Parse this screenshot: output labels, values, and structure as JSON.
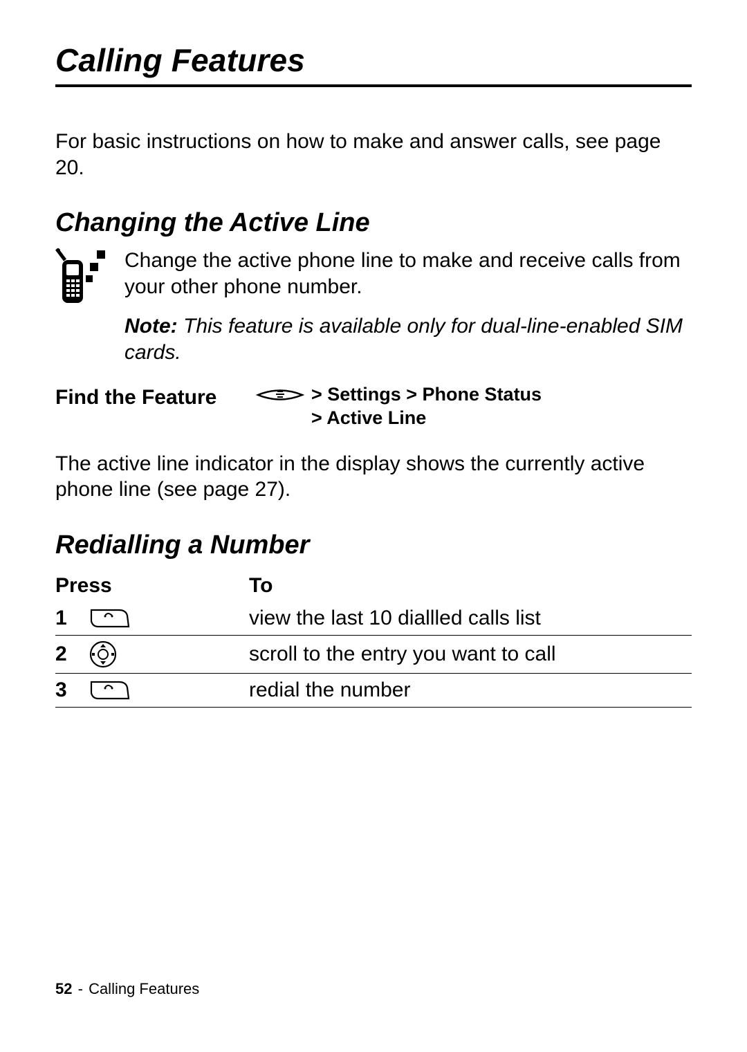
{
  "chapter": {
    "title": "Calling Features"
  },
  "intro": "For basic instructions on how to make and answer calls, see page 20.",
  "section1": {
    "title": "Changing the Active Line",
    "para": "Change the active phone line to make and receive calls from your other phone number.",
    "note_label": "Note:",
    "note_text": "This feature is available only for dual-line-enabled SIM cards.",
    "find_label": "Find the Feature",
    "find_path_line1": "> Settings > Phone Status",
    "find_path_line2": "> Active Line",
    "after": "The active line indicator in the display shows the currently active phone line (see page 27)."
  },
  "section2": {
    "title": "Redialling a Number",
    "table": {
      "head_press": "Press",
      "head_to": "To",
      "rows": [
        {
          "n": "1",
          "to": "view the last 10 diallled calls list"
        },
        {
          "n": "2",
          "to": "scroll to the entry you want to call"
        },
        {
          "n": "3",
          "to": "redial the number"
        }
      ]
    }
  },
  "footer": {
    "pageno": "52",
    "section": "Calling Features"
  }
}
